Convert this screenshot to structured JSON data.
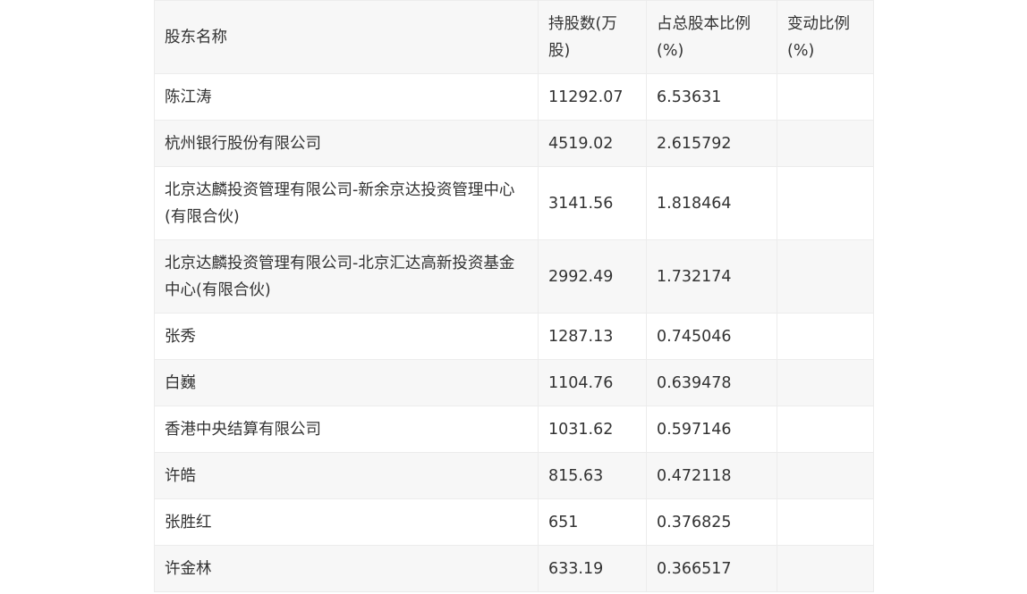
{
  "table": {
    "headers": [
      "股东名称",
      "持股数(万股)",
      "占总股本比例(%)",
      "变动比例(%)"
    ],
    "rows": [
      {
        "name": "陈江涛",
        "shares": "11292.07",
        "ratio": "6.53631",
        "change": ""
      },
      {
        "name": "杭州银行股份有限公司",
        "shares": "4519.02",
        "ratio": "2.615792",
        "change": ""
      },
      {
        "name": "北京达麟投资管理有限公司-新余京达投资管理中心(有限合伙)",
        "shares": "3141.56",
        "ratio": "1.818464",
        "change": ""
      },
      {
        "name": "北京达麟投资管理有限公司-北京汇达高新投资基金中心(有限合伙)",
        "shares": "2992.49",
        "ratio": "1.732174",
        "change": ""
      },
      {
        "name": "张秀",
        "shares": "1287.13",
        "ratio": "0.745046",
        "change": ""
      },
      {
        "name": "白巍",
        "shares": "1104.76",
        "ratio": "0.639478",
        "change": ""
      },
      {
        "name": "香港中央结算有限公司",
        "shares": "1031.62",
        "ratio": "0.597146",
        "change": ""
      },
      {
        "name": "许皓",
        "shares": "815.63",
        "ratio": "0.472118",
        "change": ""
      },
      {
        "name": "张胜红",
        "shares": "651",
        "ratio": "0.376825",
        "change": ""
      },
      {
        "name": "许金林",
        "shares": "633.19",
        "ratio": "0.366517",
        "change": ""
      }
    ]
  }
}
